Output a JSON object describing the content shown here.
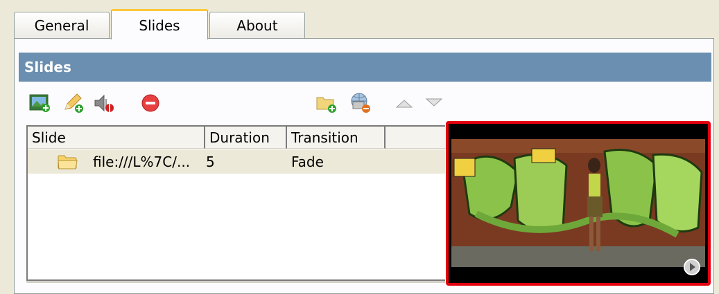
{
  "tabs": [
    {
      "label": "General",
      "active": false
    },
    {
      "label": "Slides",
      "active": true
    },
    {
      "label": "About",
      "active": false
    }
  ],
  "section": {
    "title": "Slides"
  },
  "toolbar": {
    "icons": [
      "add-image-icon",
      "edit-pencil-icon",
      "add-audio-icon",
      "remove-icon",
      "add-folder-icon",
      "remove-web-icon",
      "move-up-icon",
      "move-down-icon"
    ]
  },
  "table": {
    "columns": [
      "Slide",
      "Duration",
      "Transition",
      ""
    ],
    "rows": [
      {
        "icon": "folder-icon",
        "slide": "file:///L%7C/...",
        "duration": "5",
        "transition": "Fade"
      }
    ]
  },
  "preview": {
    "highlight_color": "#e3000f",
    "play_icon": "play-icon"
  },
  "colors": {
    "header_bg": "#6a8fb0",
    "active_tab_accent": "#ffc83c"
  }
}
